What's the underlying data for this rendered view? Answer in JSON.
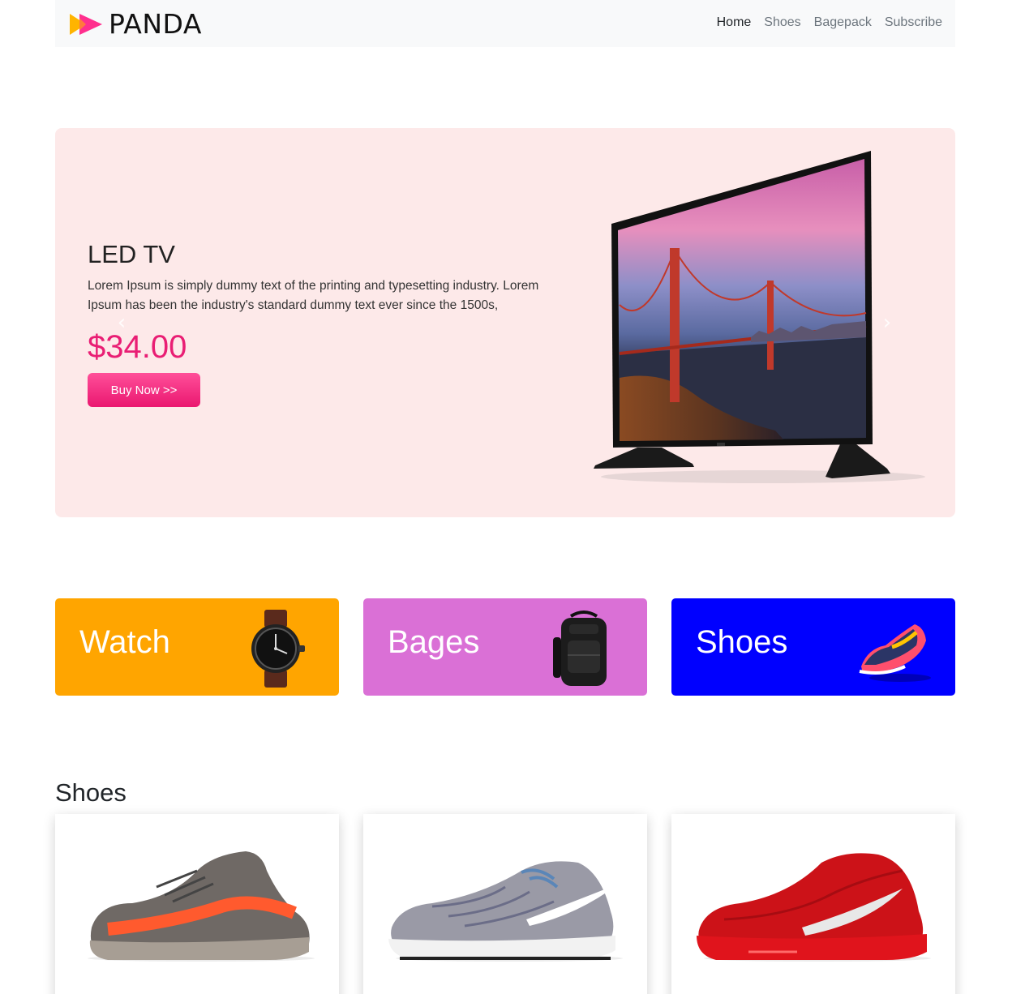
{
  "navbar": {
    "brand": "PANDA",
    "links": [
      {
        "label": "Home",
        "active": true
      },
      {
        "label": "Shoes",
        "active": false
      },
      {
        "label": "Bagepack",
        "active": false
      },
      {
        "label": "Subscribe",
        "active": false
      }
    ]
  },
  "hero": {
    "title": "LED TV",
    "description": "Lorem Ipsum is simply dummy text of the printing and typesetting industry. Lorem Ipsum has been the industry's standard dummy text ever since the 1500s,",
    "price": "$34.00",
    "button_label": "Buy Now >>",
    "prev_icon": "chevron-left-icon",
    "next_icon": "chevron-right-icon",
    "background": "#fde9e9",
    "accent": "#e91e74"
  },
  "categories": [
    {
      "label": "Watch",
      "color": "#ffa500",
      "icon": "watch-image"
    },
    {
      "label": "Bages",
      "color": "#da70d6",
      "icon": "backpack-image"
    },
    {
      "label": "Shoes",
      "color": "#0000ff",
      "icon": "sneaker-image"
    }
  ],
  "shoes_section": {
    "title": "Shoes",
    "products": [
      {
        "image": "grey-orange-sneaker-image"
      },
      {
        "image": "patterned-nike-sneaker-image"
      },
      {
        "image": "red-nike-airmax-image"
      }
    ]
  }
}
